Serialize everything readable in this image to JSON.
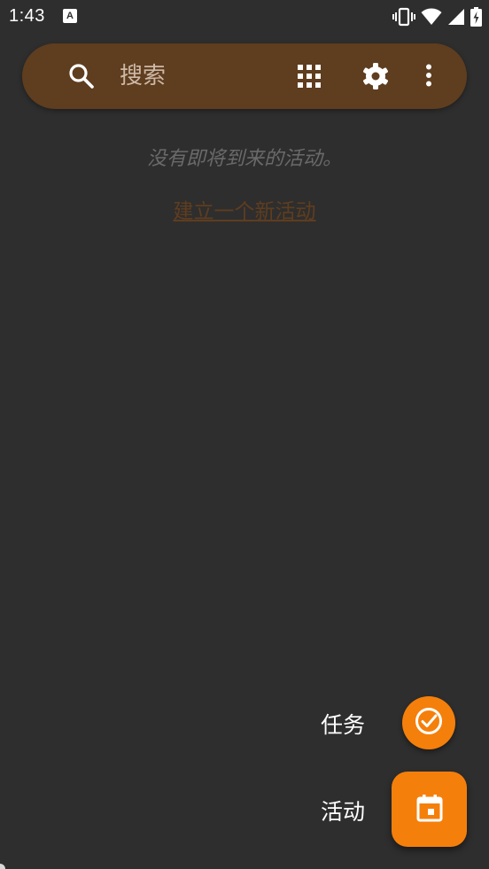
{
  "status_bar": {
    "time": "1:43",
    "notification_letter": "A"
  },
  "search_bar": {
    "placeholder": "搜索",
    "icons": [
      "search-icon",
      "grid-icon",
      "gear-icon",
      "more-vert-icon"
    ],
    "background_color": "#5f3d1f"
  },
  "empty_state": {
    "message": "没有即将到来的活动。",
    "create_link": "建立一个新活动"
  },
  "fab_menu": {
    "task_label": "任务",
    "event_label": "活动",
    "accent_color": "#f57f0b"
  }
}
